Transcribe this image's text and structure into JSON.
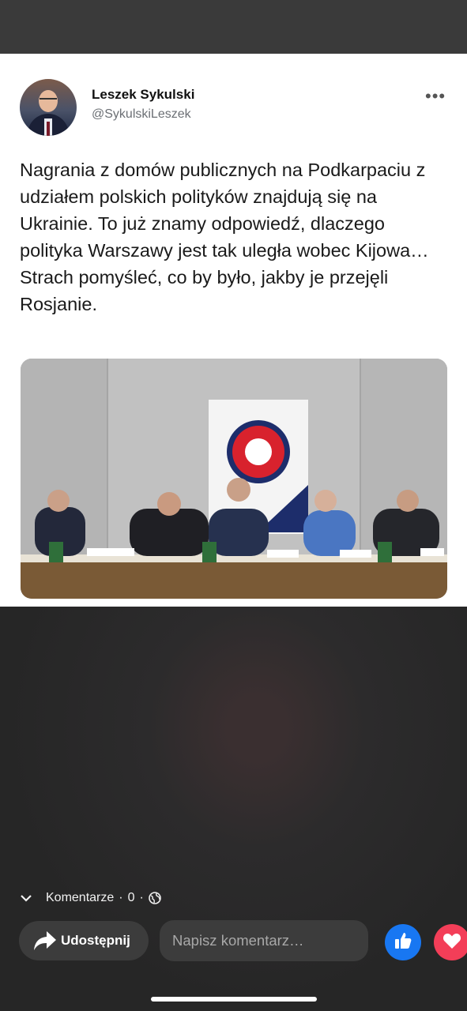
{
  "tweet": {
    "author_name": "Leszek Sykulski",
    "author_handle": "@SykulskiLeszek",
    "text": "Nagrania z domów publicznych na Podkarpaciu z udziałem polskich polityków znajdują się na Ukrainie. To już znamy odpowiedź, dlaczego polityka Warszawy jest tak uległa wobec Kijowa… Strach pomyśleć, co by było, jakby je przejęli Rosjanie.",
    "more_icon": "more-horizontal-icon"
  },
  "footer": {
    "comments_label": "Komentarze",
    "separator": "·",
    "comments_count": "0",
    "audience_icon": "globe-icon",
    "share_label": "Udostępnij",
    "comment_placeholder": "Napisz komentarz…",
    "like_icon": "thumbs-up-icon",
    "love_icon": "heart-icon"
  },
  "colors": {
    "like": "#1877f2",
    "love": "#f33e58",
    "card_bg": "#ffffff",
    "overlay_bg": "#2a2a2a"
  }
}
